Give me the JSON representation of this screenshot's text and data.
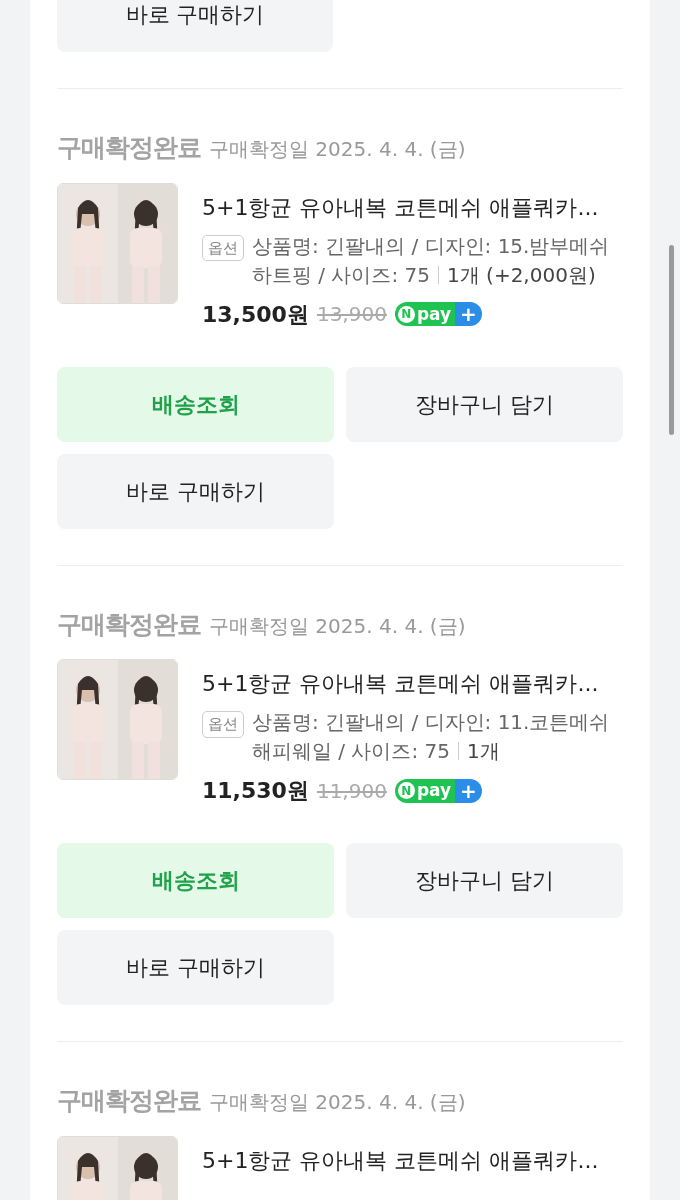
{
  "top_button": {
    "label": "바로 구매하기"
  },
  "orders": [
    {
      "status": "구매확정완료",
      "date": "구매확정일 2025. 4. 4. (금)",
      "title": "5+1항균 유아내복 코튼메쉬 애플쿼카...",
      "option_tag": "옵션",
      "option_text": "상품명: 긴팔내의 / 디자인: 15.밤부메쉬 하트핑 / 사이즈: 75",
      "quantity": "1개 (+2,000원)",
      "price": "13,500원",
      "original_price": "13,900",
      "pay_badge": {
        "mark": "N",
        "label": "pay",
        "plus": "+"
      },
      "buttons": [
        {
          "label": "배송조회",
          "kind": "primary"
        },
        {
          "label": "장바구니 담기",
          "kind": "secondary"
        },
        {
          "label": "바로 구매하기",
          "kind": "secondary"
        }
      ]
    },
    {
      "status": "구매확정완료",
      "date": "구매확정일 2025. 4. 4. (금)",
      "title": "5+1항균 유아내복 코튼메쉬 애플쿼카...",
      "option_tag": "옵션",
      "option_text": "상품명: 긴팔내의 / 디자인: 11.코튼메쉬 해피웨일 / 사이즈: 75",
      "quantity": "1개",
      "price": "11,530원",
      "original_price": "11,900",
      "pay_badge": {
        "mark": "N",
        "label": "pay",
        "plus": "+"
      },
      "buttons": [
        {
          "label": "배송조회",
          "kind": "primary"
        },
        {
          "label": "장바구니 담기",
          "kind": "secondary"
        },
        {
          "label": "바로 구매하기",
          "kind": "secondary"
        }
      ]
    },
    {
      "status": "구매확정완료",
      "date": "구매확정일 2025. 4. 4. (금)",
      "title": "5+1항균 유아내복 코튼메쉬 애플쿼카..."
    }
  ]
}
